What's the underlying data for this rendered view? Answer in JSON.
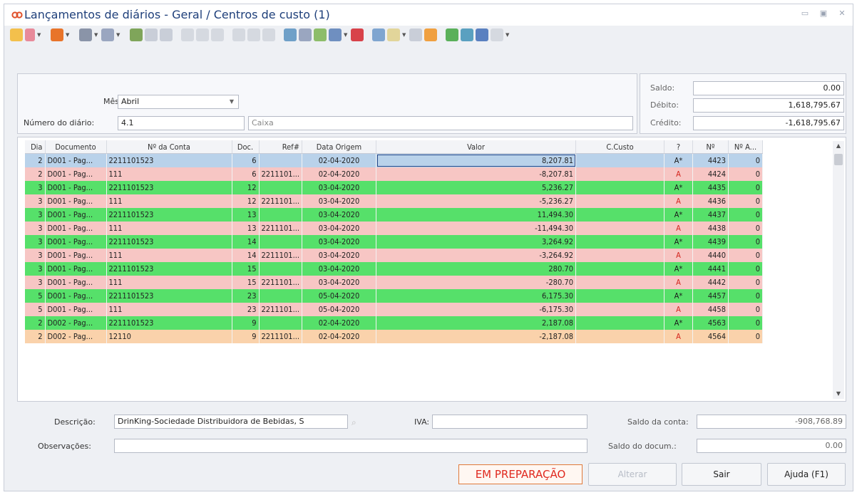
{
  "window": {
    "title": "Lançamentos de diários - Geral / Centros de custo (1)",
    "icon": "chain-link-icon"
  },
  "header": {
    "mes_label": "Mês:",
    "mes_value": "Abril",
    "numero_label": "Número do diário:",
    "numero_value": "4.1",
    "numero_desc": "Caixa"
  },
  "saldos": {
    "saldo_label": "Saldo:",
    "saldo_value": "0.00",
    "debito_label": "Débito:",
    "debito_value": "1,618,795.67",
    "credito_label": "Crédito:",
    "credito_value": "-1,618,795.67"
  },
  "grid": {
    "columns": [
      "Dia",
      "Documento",
      "Nº da Conta",
      "Doc.",
      "Ref#",
      "Data Origem",
      "Valor",
      "C.Custo",
      "?",
      "Nº",
      "Nº A..."
    ],
    "rows": [
      {
        "dia": "2",
        "documento": "D001 - Pag...",
        "conta": "2211101523",
        "doc": "6",
        "ref": "",
        "data": "02-04-2020",
        "valor": "8,207.81",
        "ccusto": "",
        "q": "A*",
        "n": "4423",
        "na": "0",
        "style": "first"
      },
      {
        "dia": "2",
        "documento": "D001 - Pag...",
        "conta": "111",
        "doc": "6",
        "ref": "2211101...",
        "data": "02-04-2020",
        "valor": "-8,207.81",
        "ccusto": "",
        "q": "A",
        "n": "4424",
        "na": "0",
        "style": "pink"
      },
      {
        "dia": "3",
        "documento": "D001 - Pag...",
        "conta": "2211101523",
        "doc": "12",
        "ref": "",
        "data": "03-04-2020",
        "valor": "5,236.27",
        "ccusto": "",
        "q": "A*",
        "n": "4435",
        "na": "0",
        "style": "green"
      },
      {
        "dia": "3",
        "documento": "D001 - Pag...",
        "conta": "111",
        "doc": "12",
        "ref": "2211101...",
        "data": "03-04-2020",
        "valor": "-5,236.27",
        "ccusto": "",
        "q": "A",
        "n": "4436",
        "na": "0",
        "style": "pink"
      },
      {
        "dia": "3",
        "documento": "D001 - Pag...",
        "conta": "2211101523",
        "doc": "13",
        "ref": "",
        "data": "03-04-2020",
        "valor": "11,494.30",
        "ccusto": "",
        "q": "A*",
        "n": "4437",
        "na": "0",
        "style": "green"
      },
      {
        "dia": "3",
        "documento": "D001 - Pag...",
        "conta": "111",
        "doc": "13",
        "ref": "2211101...",
        "data": "03-04-2020",
        "valor": "-11,494.30",
        "ccusto": "",
        "q": "A",
        "n": "4438",
        "na": "0",
        "style": "pink"
      },
      {
        "dia": "3",
        "documento": "D001 - Pag...",
        "conta": "2211101523",
        "doc": "14",
        "ref": "",
        "data": "03-04-2020",
        "valor": "3,264.92",
        "ccusto": "",
        "q": "A*",
        "n": "4439",
        "na": "0",
        "style": "green"
      },
      {
        "dia": "3",
        "documento": "D001 - Pag...",
        "conta": "111",
        "doc": "14",
        "ref": "2211101...",
        "data": "03-04-2020",
        "valor": "-3,264.92",
        "ccusto": "",
        "q": "A",
        "n": "4440",
        "na": "0",
        "style": "pink"
      },
      {
        "dia": "3",
        "documento": "D001 - Pag...",
        "conta": "2211101523",
        "doc": "15",
        "ref": "",
        "data": "03-04-2020",
        "valor": "280.70",
        "ccusto": "",
        "q": "A*",
        "n": "4441",
        "na": "0",
        "style": "green"
      },
      {
        "dia": "3",
        "documento": "D001 - Pag...",
        "conta": "111",
        "doc": "15",
        "ref": "2211101...",
        "data": "03-04-2020",
        "valor": "-280.70",
        "ccusto": "",
        "q": "A",
        "n": "4442",
        "na": "0",
        "style": "pink"
      },
      {
        "dia": "5",
        "documento": "D001 - Pag...",
        "conta": "2211101523",
        "doc": "23",
        "ref": "",
        "data": "05-04-2020",
        "valor": "6,175.30",
        "ccusto": "",
        "q": "A*",
        "n": "4457",
        "na": "0",
        "style": "green"
      },
      {
        "dia": "5",
        "documento": "D001 - Pag...",
        "conta": "111",
        "doc": "23",
        "ref": "2211101...",
        "data": "05-04-2020",
        "valor": "-6,175.30",
        "ccusto": "",
        "q": "A",
        "n": "4458",
        "na": "0",
        "style": "pink"
      },
      {
        "dia": "2",
        "documento": "D002 - Pag...",
        "conta": "2211101523",
        "doc": "9",
        "ref": "",
        "data": "02-04-2020",
        "valor": "2,187.08",
        "ccusto": "",
        "q": "A*",
        "n": "4563",
        "na": "0",
        "style": "green"
      },
      {
        "dia": "2",
        "documento": "D002 - Pag...",
        "conta": "12110",
        "doc": "9",
        "ref": "2211101...",
        "data": "02-04-2020",
        "valor": "-2,187.08",
        "ccusto": "",
        "q": "A",
        "n": "4564",
        "na": "0",
        "style": "orange"
      }
    ]
  },
  "footer": {
    "descricao_label": "Descrição:",
    "descricao_value": "DrinKing-Sociedade Distribuidora de Bebidas, S",
    "iva_label": "IVA:",
    "iva_value": "",
    "obs_label": "Observações:",
    "obs_value": "",
    "saldo_conta_label": "Saldo da conta:",
    "saldo_conta_value": "-908,768.89",
    "saldo_doc_label": "Saldo do docum.:",
    "saldo_doc_value": "0.00",
    "status_text": "EM PREPARAÇÃO",
    "alterar_label": "Alterar",
    "sair_label": "Sair",
    "ajuda_label": "Ajuda (F1)"
  },
  "colors": {
    "first_row": "#b9d2ea",
    "pink_row": "#f7c6c4",
    "green_row": "#56e06a",
    "orange_row": "#fad2ab",
    "status_red": "#e0291f",
    "title_blue": "#1e3f7a"
  }
}
